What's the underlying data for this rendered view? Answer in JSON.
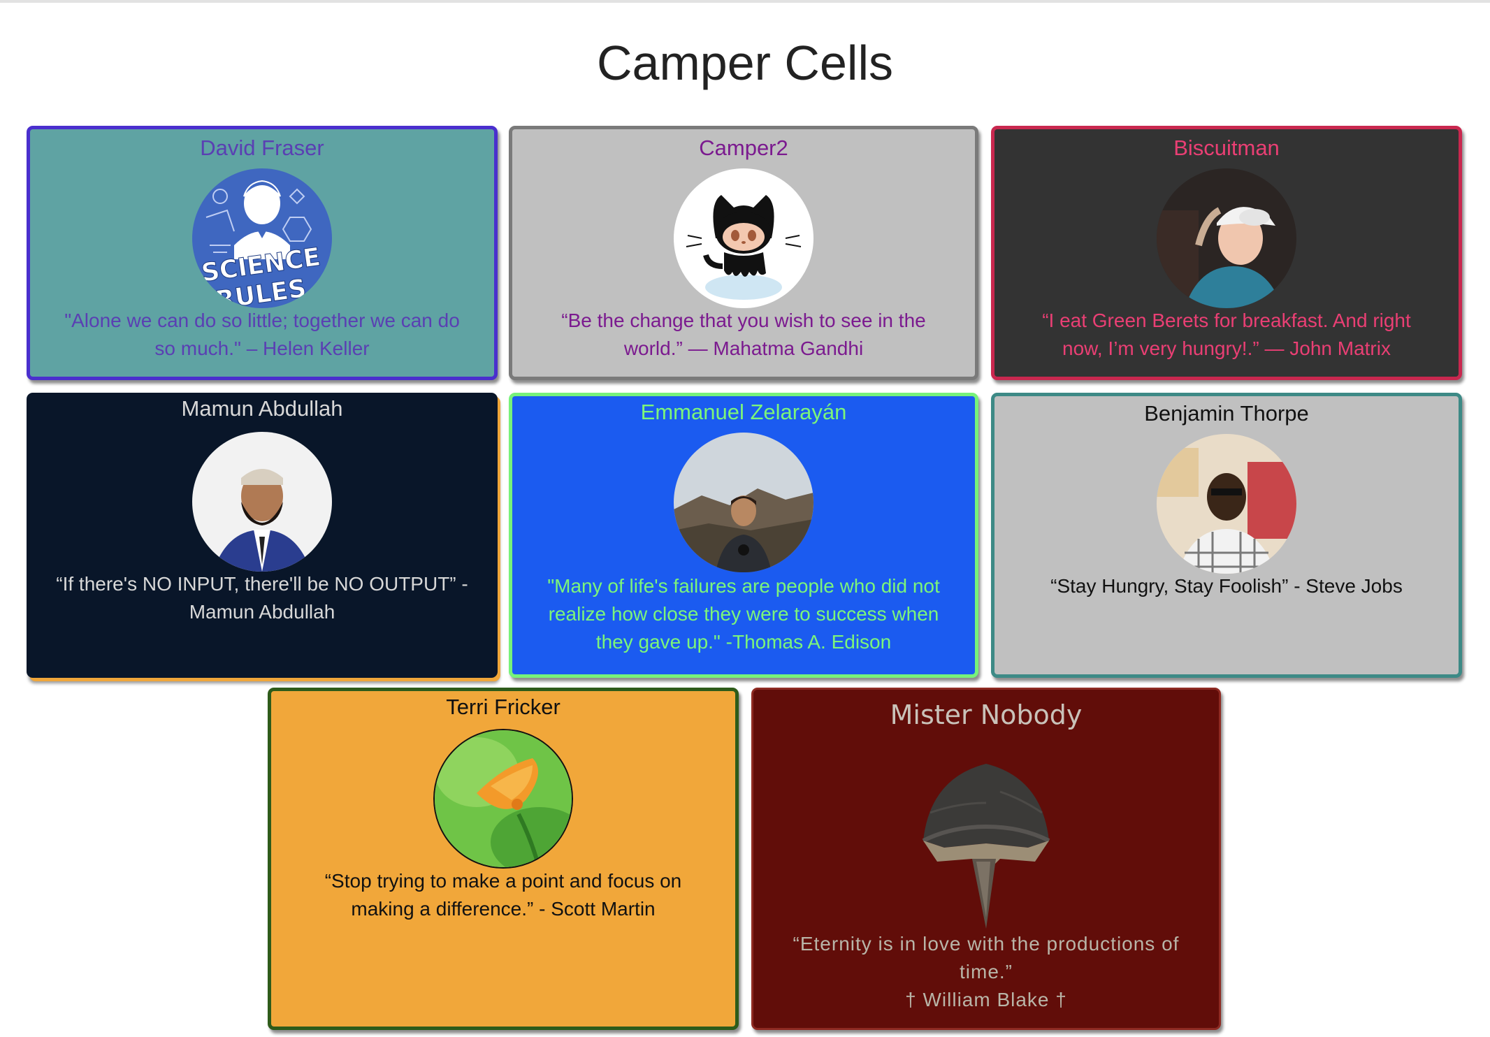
{
  "page": {
    "title": "Camper Cells"
  },
  "cards": [
    {
      "name": "David Fraser",
      "quote": "\"Alone we can do so little; together we can do so much.\" – Helen Keller",
      "avatar_icon": "science-rules-poster",
      "avatar_text": "SCIENCE RULES",
      "colors": {
        "bg": "#5fa3a3",
        "border": "#4a2fce",
        "text": "#5a3fb3"
      }
    },
    {
      "name": "Camper2",
      "quote": "“Be the change that you wish to see in the world.” — Mahatma Gandhi",
      "avatar_icon": "octocat-avatar",
      "colors": {
        "bg": "#c0c0c0",
        "border": "#7a7a7a",
        "text": "#7b1a8f"
      }
    },
    {
      "name": "Biscuitman",
      "quote": "“I eat Green Berets for breakfast. And right now, I’m very hungry!.” — John Matrix",
      "avatar_icon": "person-photo",
      "colors": {
        "bg": "#333333",
        "border": "#c9284f",
        "text": "#ea3f74"
      }
    },
    {
      "name": "Mamun Abdullah",
      "quote": "“If there's NO INPUT, there'll be NO OUTPUT” - Mamun Abdullah",
      "avatar_icon": "person-photo",
      "colors": {
        "bg": "#091629",
        "border": "#f0a63a",
        "text": "#d8d8d8"
      }
    },
    {
      "name": "Emmanuel Zelarayán",
      "quote": "\"Many of life's failures are people who did not realize how close they were to success when they gave up.\" -Thomas A. Edison",
      "avatar_icon": "person-photo",
      "colors": {
        "bg": "#1b5bf0",
        "border": "#77f27a",
        "text": "#7cf57a"
      }
    },
    {
      "name": "Benjamin Thorpe",
      "quote": "“Stay Hungry, Stay Foolish” - Steve Jobs",
      "avatar_icon": "person-photo",
      "colors": {
        "bg": "#c0c0c0",
        "border": "#3d8a86",
        "text": "#111111"
      }
    },
    {
      "name": "Terri Fricker",
      "quote": "“Stop trying to make a point and focus on making a difference.” - Scott Martin",
      "avatar_icon": "orange-poppy-flower",
      "colors": {
        "bg": "#f1a73a",
        "border": "#2e5b1a",
        "text": "#111111"
      }
    },
    {
      "name": "Mister Nobody",
      "quote": "“Eternity is in love with the productions of time.”",
      "attribution": "† William Blake †",
      "avatar_icon": "stone-mushroom-sculpture",
      "colors": {
        "bg": "#610d09",
        "border": "#8e2a22",
        "text": "#b9b5a8",
        "name_text": "#c9c2b9"
      }
    }
  ]
}
